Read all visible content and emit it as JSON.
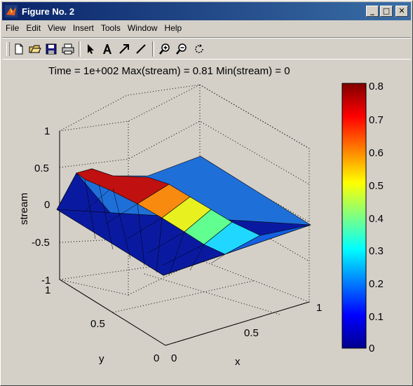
{
  "window": {
    "title": "Figure No. 2"
  },
  "controls": {
    "minimize": "_",
    "maximize": "□",
    "close": "✕"
  },
  "menu": [
    {
      "label": "File"
    },
    {
      "label": "Edit"
    },
    {
      "label": "View"
    },
    {
      "label": "Insert"
    },
    {
      "label": "Tools"
    },
    {
      "label": "Window"
    },
    {
      "label": "Help"
    }
  ],
  "toolbar": {
    "icons": [
      "new-figure-icon",
      "open-file-icon",
      "save-icon",
      "print-icon",
      "select-arrow-icon",
      "insert-text-icon",
      "insert-arrow-icon",
      "insert-line-icon",
      "zoom-in-icon",
      "zoom-out-icon",
      "rotate-3d-icon"
    ]
  },
  "plot": {
    "title": "Time = 1e+002     Max(stream) = 0.81     Min(stream) = 0",
    "zlabel": "stream",
    "xlabel": "x",
    "ylabel": "y",
    "zticks": [
      "1",
      "0.5",
      "0",
      "-0.5",
      "-1"
    ],
    "xticks": [
      "0",
      "0.5",
      "1"
    ],
    "yticks": [
      "0",
      "0.5",
      "1"
    ],
    "colorbar_ticks": [
      "0.8",
      "0.7",
      "0.6",
      "0.5",
      "0.4",
      "0.3",
      "0.2",
      "0.1",
      "0"
    ]
  },
  "chart_data": {
    "type": "surface",
    "colormap": "jet",
    "x_range": [
      0,
      1
    ],
    "y_range": [
      0,
      1
    ],
    "z_range": [
      -1,
      1
    ],
    "color_range": [
      0,
      0.81
    ],
    "max": 0.81,
    "min": 0,
    "grid": true
  }
}
